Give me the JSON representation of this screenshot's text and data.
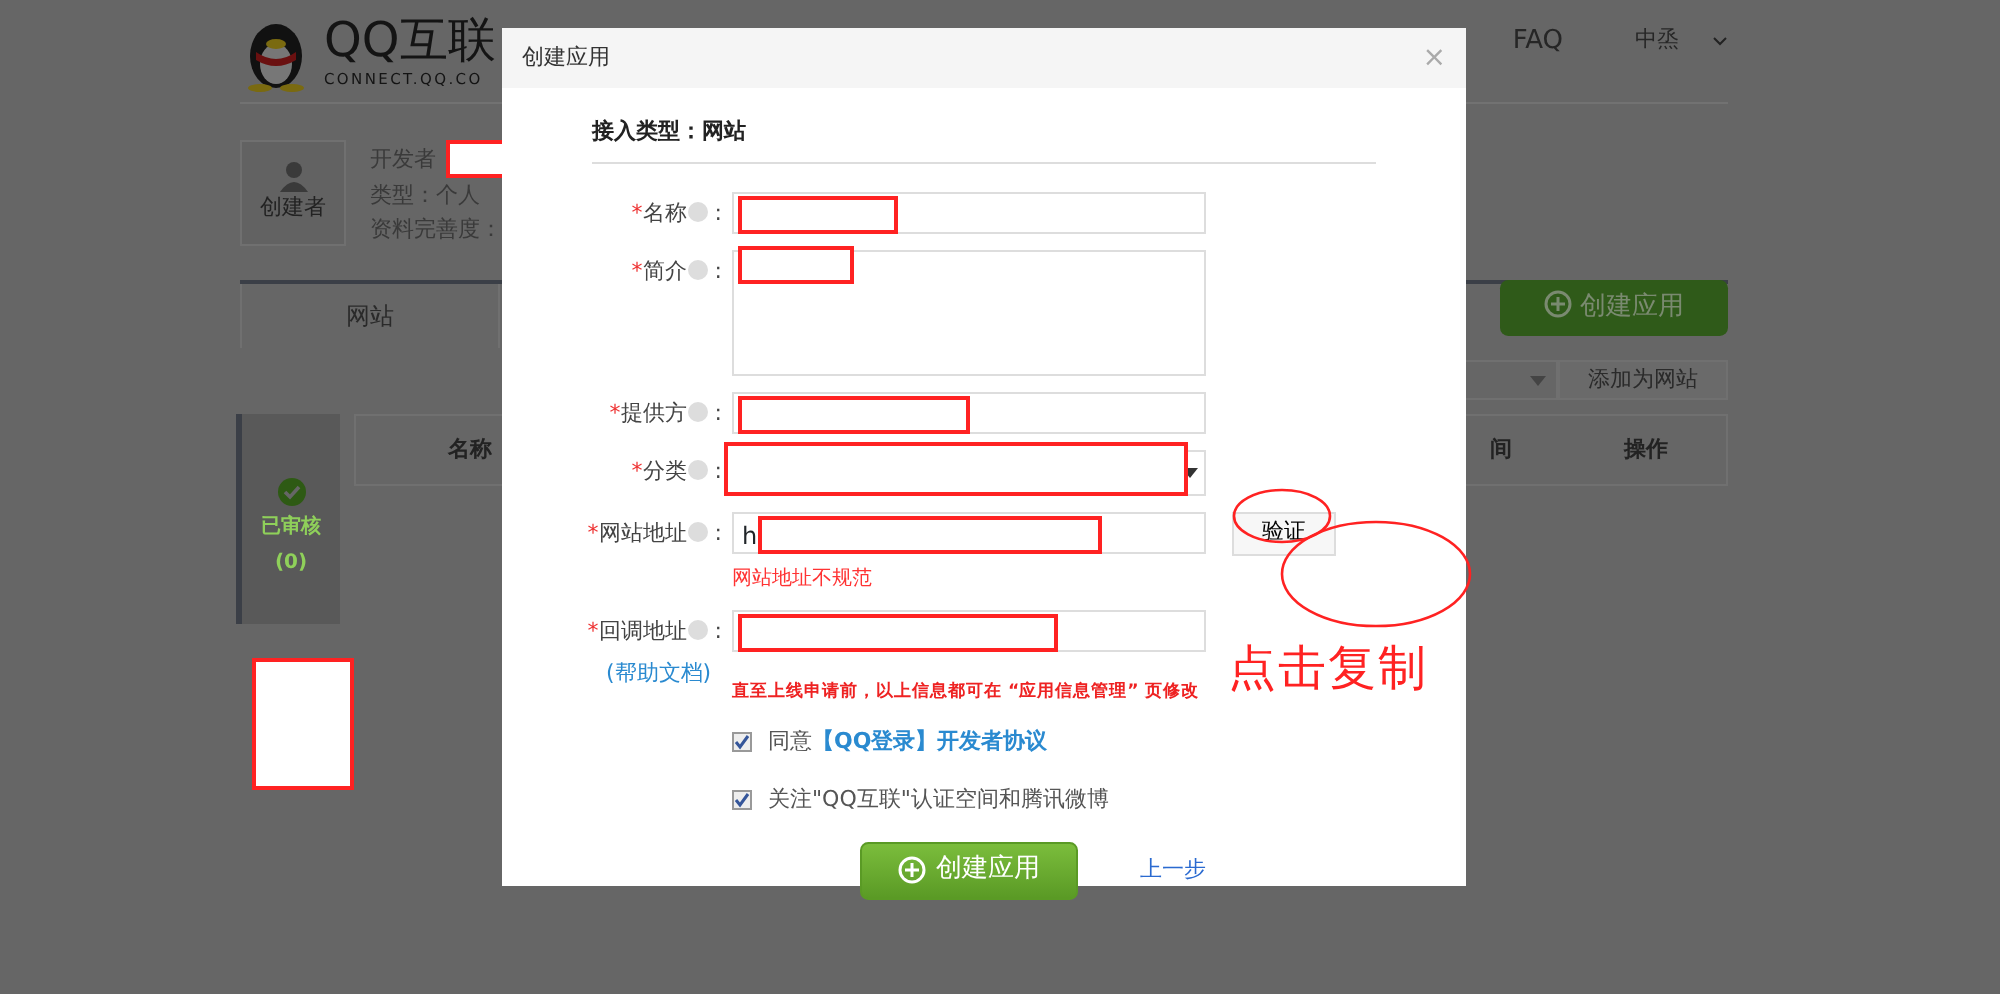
{
  "page": {
    "logo": {
      "title": "QQ互联",
      "subtitle": "CONNECT.QQ.CO"
    },
    "nav": [
      {
        "label": "FAQ"
      }
    ],
    "user": {
      "name": "中烝"
    },
    "profile": {
      "role": "创建者",
      "lines": [
        "开发者",
        "类型：个人",
        "资料完善度："
      ]
    },
    "tabs": [
      {
        "label": "网站",
        "selected": true
      }
    ],
    "create_button": "创建应用",
    "add_button": "添加为网站",
    "table": {
      "columns": [
        "名称",
        "间",
        "操作"
      ]
    },
    "side_status": {
      "label": "已审核",
      "count": "(0)"
    }
  },
  "dialog": {
    "title": "创建应用",
    "close": "×",
    "heading": "接入类型：网站",
    "fields": [
      {
        "kind": "input",
        "mark": "*",
        "label": "名称",
        "colon": ":"
      },
      {
        "kind": "textarea",
        "mark": "*",
        "label": "简介",
        "colon": ":"
      },
      {
        "kind": "input",
        "mark": "*",
        "label": "提供方",
        "colon": ":"
      },
      {
        "kind": "select",
        "mark": "*",
        "label": "分类",
        "colon": ":"
      },
      {
        "kind": "input",
        "mark": "*",
        "label": "网站地址",
        "colon": ":",
        "value": "h",
        "button": "验证",
        "error": "网站地址不规范"
      },
      {
        "kind": "input",
        "mark": "*",
        "label": "回调地址",
        "colon": ":",
        "help_link": "(帮助文档)"
      }
    ],
    "notice": "直至上线申请前，以上信息都可在 “应用信息管理” 页修改",
    "checkboxes": [
      {
        "checked": true,
        "parts": [
          {
            "kind": "text",
            "text": "同意"
          },
          {
            "kind": "link",
            "text": "【QQ登录】开发者协议"
          }
        ]
      },
      {
        "checked": true,
        "parts": [
          {
            "kind": "text",
            "text": "关注\"QQ互联\"认证空间和腾讯微博"
          }
        ]
      }
    ],
    "submit": "创建应用",
    "back": "上一步"
  },
  "annotation": {
    "text": "点击复制"
  }
}
